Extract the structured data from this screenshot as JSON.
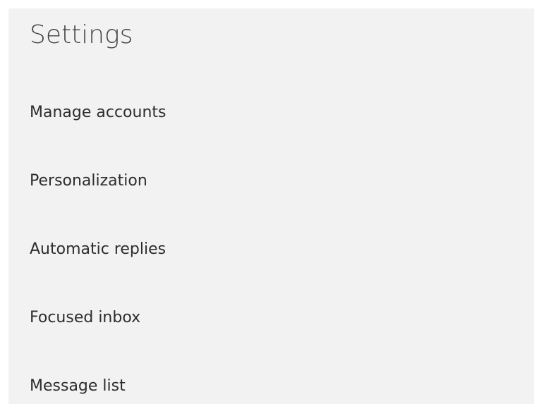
{
  "panel": {
    "title": "Settings",
    "items": [
      {
        "label": "Manage accounts"
      },
      {
        "label": "Personalization"
      },
      {
        "label": "Automatic replies"
      },
      {
        "label": "Focused inbox"
      },
      {
        "label": "Message list"
      }
    ]
  }
}
